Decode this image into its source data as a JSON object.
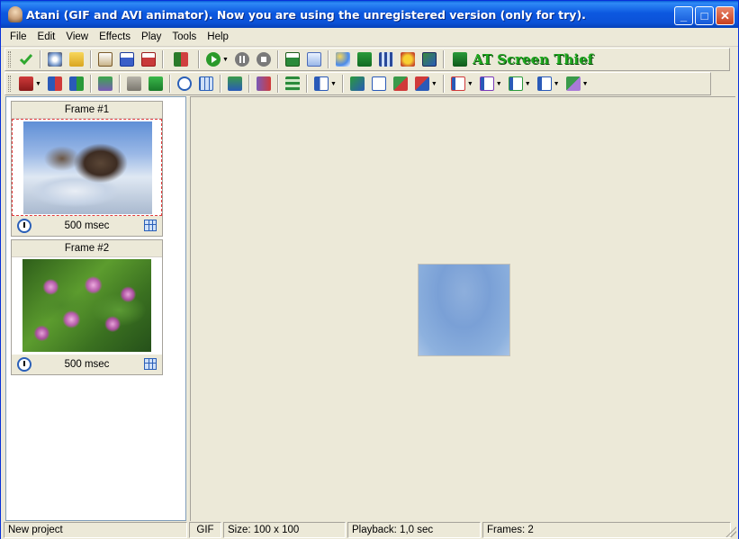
{
  "window": {
    "title": "Atani (GIF and AVI animator). Now you are using the unregistered version (only for try).",
    "minimize_label": "_",
    "maximize_label": "□",
    "close_label": "✕"
  },
  "menu": [
    "File",
    "Edit",
    "View",
    "Effects",
    "Play",
    "Tools",
    "Help"
  ],
  "toolbar": {
    "screen_thief_label": "AT Screen Thief"
  },
  "frames": [
    {
      "title": "Frame #1",
      "delay": "500 msec",
      "thumbnail": "dragon-on-snow-image",
      "selected": true
    },
    {
      "title": "Frame #2",
      "delay": "500 msec",
      "thumbnail": "pink-water-lilies-image",
      "selected": false
    }
  ],
  "status": {
    "project": "New project",
    "format": "GIF",
    "size": "Size: 100 x 100",
    "playback": "Playback: 1,0 sec",
    "frames": "Frames: 2"
  },
  "colors": {
    "titlebar": "#0b52d8",
    "background": "#ece9d8",
    "accent_green": "#1fa81f",
    "selection_border": "#e03a3a"
  }
}
